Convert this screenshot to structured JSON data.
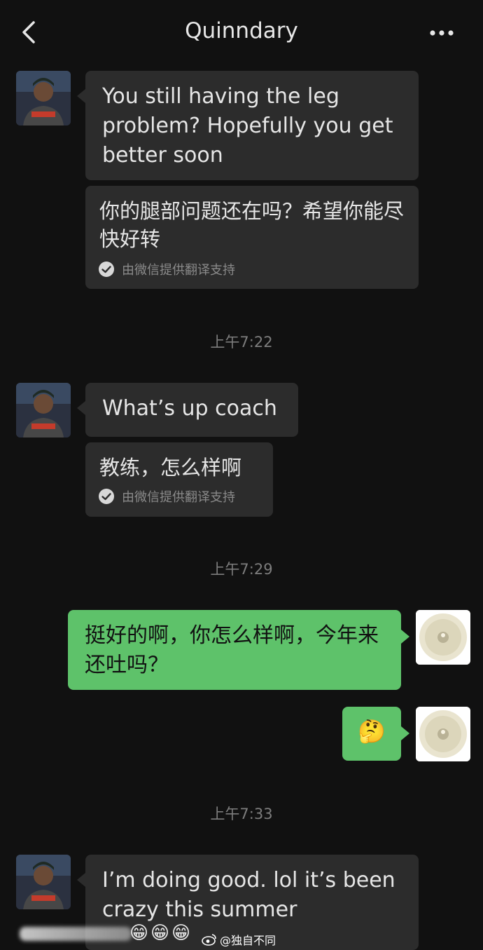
{
  "header": {
    "title": "Quinndary"
  },
  "messages": {
    "m1_text": "You still having the leg problem? Hopefully you get better soon",
    "m1_translation": "你的腿部问题还在吗？希望你能尽快好转",
    "translation_note": "由微信提供翻译支持",
    "time1": "上午7:22",
    "m2_text": "What’s up coach",
    "m2_translation": "教练，怎么样啊",
    "time2": "上午7:29",
    "m3_text": "挺好的啊，你怎么样啊，今年来还吐吗？",
    "m4_emoji": "🤔",
    "time3": "上午7:33",
    "m5_text": "I’m doing good. lol it’s been crazy this summer"
  },
  "watermark": {
    "emojis": [
      "😁",
      "😁",
      "😁"
    ],
    "handle": "@独自不同"
  },
  "colors": {
    "background": "#111111",
    "received_bubble": "#2c2c2c",
    "sent_bubble": "#5ec26a"
  }
}
